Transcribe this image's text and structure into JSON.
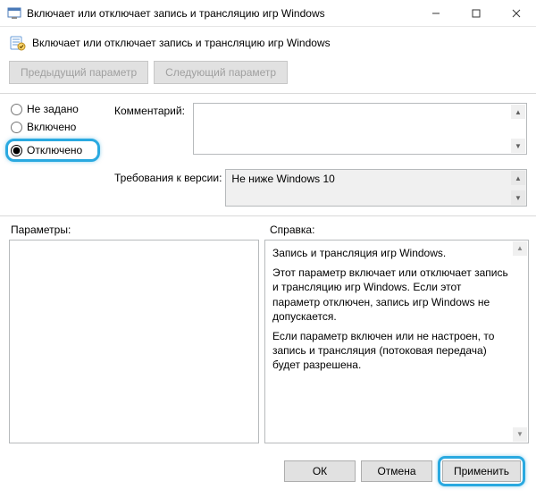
{
  "window": {
    "title": "Включает или отключает запись и трансляцию игр Windows"
  },
  "header": {
    "subtitle": "Включает или отключает запись и трансляцию игр Windows",
    "prev_button": "Предыдущий параметр",
    "next_button": "Следующий параметр"
  },
  "state": {
    "not_configured": "Не задано",
    "enabled": "Включено",
    "disabled": "Отключено",
    "selected": "disabled"
  },
  "comment": {
    "label": "Комментарий:",
    "value": ""
  },
  "supported": {
    "label": "Требования к версии:",
    "value": "Не ниже Windows 10"
  },
  "options": {
    "label": "Параметры:"
  },
  "help": {
    "label": "Справка:",
    "p1": "Запись и трансляция игр Windows.",
    "p2": "Этот параметр включает или отключает запись и трансляцию игр Windows. Если этот параметр отключен, запись игр Windows не допускается.",
    "p3": "Если параметр включен или не настроен, то запись и трансляция (потоковая передача) будет разрешена."
  },
  "footer": {
    "ok": "ОК",
    "cancel": "Отмена",
    "apply": "Применить"
  }
}
